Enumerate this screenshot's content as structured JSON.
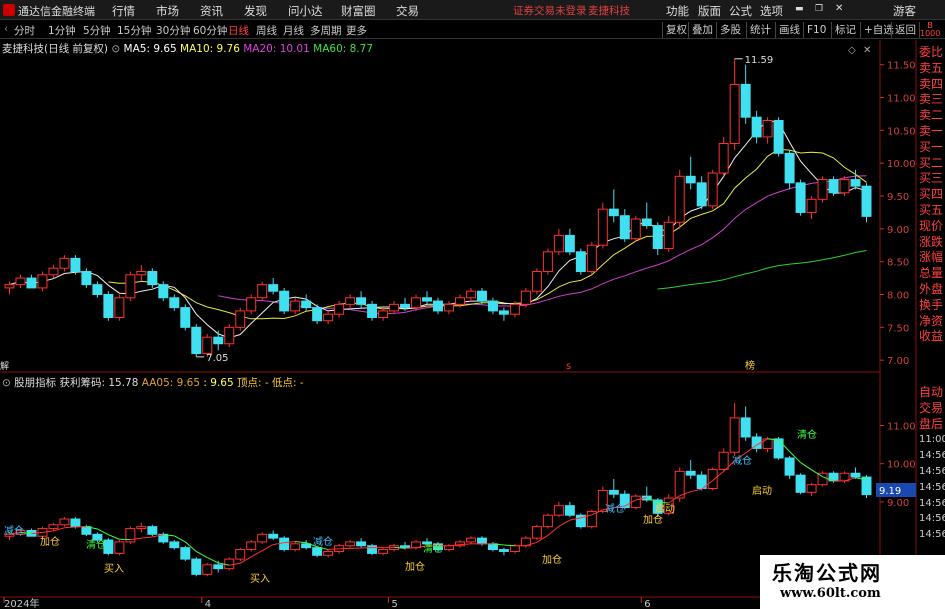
{
  "app": {
    "name": "通达信金融终端"
  },
  "menu": {
    "items": [
      "行情",
      "市场",
      "资讯",
      "发现",
      "问小达",
      "财富圈",
      "交易"
    ],
    "warning": "证券交易未登录",
    "stock_name": "麦捷科技",
    "right": [
      "功能",
      "版面",
      "公式",
      "选项"
    ],
    "guest": "游客"
  },
  "toolbar": {
    "periods": [
      "分时",
      "1分钟",
      "5分钟",
      "15分钟",
      "30分钟",
      "60分钟",
      "日线",
      "周线",
      "月线",
      "多周期",
      "更多"
    ],
    "active": "日线",
    "right": [
      "复权",
      "叠加",
      "多股",
      "统计",
      "画线",
      "F10",
      "标记",
      "+自选",
      "返回"
    ]
  },
  "info": {
    "title": "麦捷科技(日线 前复权)",
    "ma5": "MA5: 9.65",
    "ma10": "MA10: 9.76",
    "ma20": "MA20: 10.01",
    "ma60": "MA60: 8.77"
  },
  "indicator": {
    "name": "股朋指标",
    "profit": "获利筹码: 15.78",
    "aa05": "AA05: 9.65",
    "val": ": 9.65",
    "top": "顶点: -",
    "bottom": "低点: -"
  },
  "price_axis": [
    "11.50",
    "11.00",
    "10.50",
    "10.00",
    "9.50",
    "9.00",
    "8.50",
    "8.00",
    "7.50",
    "7.00"
  ],
  "indicator_axis": [
    "11.00",
    "10.00",
    "9.00"
  ],
  "indicator_price": "9.19",
  "hi_label": "11.59",
  "lo_label": "7.05",
  "x_labels": [
    "2024年",
    "4",
    "5",
    "6",
    "7"
  ],
  "markers": {
    "s": "s",
    "b": "榜",
    "j": "解"
  },
  "sidebar_top": [
    "委比",
    "卖五",
    "卖四",
    "卖三",
    "卖二",
    "卖一",
    "买一",
    "买二",
    "买三",
    "买四",
    "买五",
    "现价",
    "涨跌",
    "涨幅",
    "总量",
    "外盘",
    "换手",
    "净资",
    "收益"
  ],
  "sidebar_bot": [
    "自动",
    "交易",
    "盘后",
    "11:00",
    "14:56",
    "14:56",
    "14:56",
    "14:56",
    "14:56",
    "14:56",
    "14:56",
    "14:56"
  ],
  "top_icons": [
    "B",
    "1000"
  ],
  "signals": [
    {
      "t": "减仓",
      "c": "#40c0ff",
      "pos": [
        4,
        522
      ]
    },
    {
      "t": "加仓",
      "c": "#ffcc33",
      "pos": [
        40,
        533
      ]
    },
    {
      "t": "清仓",
      "c": "#40ff40",
      "pos": [
        86,
        536
      ]
    },
    {
      "t": "买入",
      "c": "#ffcc33",
      "pos": [
        104,
        560
      ]
    },
    {
      "t": "买入",
      "c": "#ffcc33",
      "pos": [
        250,
        570
      ]
    },
    {
      "t": "减仓",
      "c": "#40c0ff",
      "pos": [
        313,
        533
      ]
    },
    {
      "t": "清仓",
      "c": "#40ff40",
      "pos": [
        423,
        540
      ]
    },
    {
      "t": "加仓",
      "c": "#ffcc33",
      "pos": [
        405,
        558
      ]
    },
    {
      "t": "加仓",
      "c": "#ffcc33",
      "pos": [
        542,
        551
      ]
    },
    {
      "t": "减仓",
      "c": "#40c0ff",
      "pos": [
        605,
        500
      ]
    },
    {
      "t": "加仓",
      "c": "#ffcc33",
      "pos": [
        643,
        511
      ]
    },
    {
      "t": "启动",
      "c": "#ffcc33",
      "pos": [
        655,
        500
      ]
    },
    {
      "t": "减仓",
      "c": "#40c0ff",
      "pos": [
        732,
        452
      ]
    },
    {
      "t": "启动",
      "c": "#ffcc33",
      "pos": [
        752,
        482
      ]
    },
    {
      "t": "清仓",
      "c": "#40ff40",
      "pos": [
        797,
        426
      ]
    }
  ],
  "watermark": {
    "title": "乐淘公式网",
    "url": "www.60lt.com"
  },
  "chart_data": {
    "type": "candlestick",
    "panels": [
      "price",
      "indicator"
    ],
    "ylim": [
      6.85,
      11.8
    ],
    "candles": [
      [
        8.1,
        8.2,
        8.0,
        8.15
      ],
      [
        8.15,
        8.3,
        8.1,
        8.25
      ],
      [
        8.25,
        8.3,
        8.1,
        8.1
      ],
      [
        8.1,
        8.35,
        8.05,
        8.3
      ],
      [
        8.3,
        8.45,
        8.25,
        8.4
      ],
      [
        8.4,
        8.6,
        8.35,
        8.55
      ],
      [
        8.55,
        8.6,
        8.3,
        8.35
      ],
      [
        8.35,
        8.4,
        8.1,
        8.15
      ],
      [
        8.15,
        8.2,
        7.95,
        8.0
      ],
      [
        8.0,
        8.05,
        7.6,
        7.65
      ],
      [
        7.65,
        8.0,
        7.6,
        7.95
      ],
      [
        7.95,
        8.35,
        7.9,
        8.3
      ],
      [
        8.3,
        8.45,
        8.2,
        8.35
      ],
      [
        8.35,
        8.4,
        8.1,
        8.15
      ],
      [
        8.15,
        8.2,
        7.9,
        7.95
      ],
      [
        7.95,
        8.0,
        7.75,
        7.8
      ],
      [
        7.8,
        7.85,
        7.45,
        7.5
      ],
      [
        7.5,
        7.55,
        7.05,
        7.1
      ],
      [
        7.1,
        7.4,
        7.05,
        7.35
      ],
      [
        7.35,
        7.45,
        7.15,
        7.25
      ],
      [
        7.25,
        7.55,
        7.2,
        7.5
      ],
      [
        7.5,
        7.8,
        7.45,
        7.75
      ],
      [
        7.75,
        8.0,
        7.7,
        7.95
      ],
      [
        7.95,
        8.2,
        7.9,
        8.15
      ],
      [
        8.15,
        8.25,
        8.0,
        8.05
      ],
      [
        8.05,
        8.1,
        7.7,
        7.75
      ],
      [
        7.75,
        7.95,
        7.7,
        7.9
      ],
      [
        7.9,
        8.0,
        7.75,
        7.8
      ],
      [
        7.8,
        7.85,
        7.55,
        7.6
      ],
      [
        7.6,
        7.75,
        7.55,
        7.7
      ],
      [
        7.7,
        7.9,
        7.65,
        7.85
      ],
      [
        7.85,
        8.0,
        7.8,
        7.95
      ],
      [
        7.95,
        8.05,
        7.8,
        7.85
      ],
      [
        7.85,
        7.9,
        7.6,
        7.65
      ],
      [
        7.65,
        7.8,
        7.6,
        7.75
      ],
      [
        7.75,
        7.9,
        7.7,
        7.85
      ],
      [
        7.85,
        7.95,
        7.75,
        7.8
      ],
      [
        7.8,
        8.0,
        7.75,
        7.95
      ],
      [
        7.95,
        8.05,
        7.85,
        7.9
      ],
      [
        7.9,
        7.95,
        7.7,
        7.75
      ],
      [
        7.75,
        7.9,
        7.7,
        7.85
      ],
      [
        7.85,
        8.0,
        7.8,
        7.95
      ],
      [
        7.95,
        8.1,
        7.9,
        8.05
      ],
      [
        8.05,
        8.1,
        7.85,
        7.9
      ],
      [
        7.9,
        7.95,
        7.7,
        7.75
      ],
      [
        7.75,
        7.8,
        7.6,
        7.7
      ],
      [
        7.7,
        7.9,
        7.65,
        7.85
      ],
      [
        7.85,
        8.1,
        7.8,
        8.05
      ],
      [
        8.05,
        8.4,
        8.0,
        8.35
      ],
      [
        8.35,
        8.7,
        8.3,
        8.65
      ],
      [
        8.65,
        9.0,
        8.6,
        8.9
      ],
      [
        8.9,
        9.0,
        8.6,
        8.65
      ],
      [
        8.65,
        8.7,
        8.3,
        8.35
      ],
      [
        8.35,
        8.8,
        8.3,
        8.75
      ],
      [
        8.75,
        9.4,
        8.7,
        9.3
      ],
      [
        9.3,
        9.6,
        9.1,
        9.2
      ],
      [
        9.2,
        9.3,
        8.8,
        8.85
      ],
      [
        8.85,
        9.2,
        8.8,
        9.15
      ],
      [
        9.15,
        9.4,
        9.0,
        9.05
      ],
      [
        9.05,
        9.1,
        8.6,
        8.7
      ],
      [
        8.7,
        9.2,
        8.65,
        9.1
      ],
      [
        9.1,
        9.9,
        9.0,
        9.8
      ],
      [
        9.8,
        10.1,
        9.6,
        9.7
      ],
      [
        9.7,
        9.8,
        9.3,
        9.35
      ],
      [
        9.35,
        9.9,
        9.3,
        9.85
      ],
      [
        9.85,
        10.4,
        9.8,
        10.3
      ],
      [
        10.3,
        11.59,
        10.2,
        11.2
      ],
      [
        11.2,
        11.5,
        10.6,
        10.7
      ],
      [
        10.7,
        10.8,
        10.3,
        10.4
      ],
      [
        10.4,
        10.7,
        10.3,
        10.65
      ],
      [
        10.65,
        10.7,
        10.1,
        10.15
      ],
      [
        10.15,
        10.2,
        9.6,
        9.7
      ],
      [
        9.7,
        9.75,
        9.2,
        9.25
      ],
      [
        9.25,
        9.5,
        9.15,
        9.45
      ],
      [
        9.45,
        9.8,
        9.4,
        9.75
      ],
      [
        9.75,
        9.8,
        9.5,
        9.55
      ],
      [
        9.55,
        9.8,
        9.5,
        9.75
      ],
      [
        9.75,
        9.9,
        9.6,
        9.65
      ],
      [
        9.65,
        9.7,
        9.1,
        9.19
      ]
    ]
  }
}
